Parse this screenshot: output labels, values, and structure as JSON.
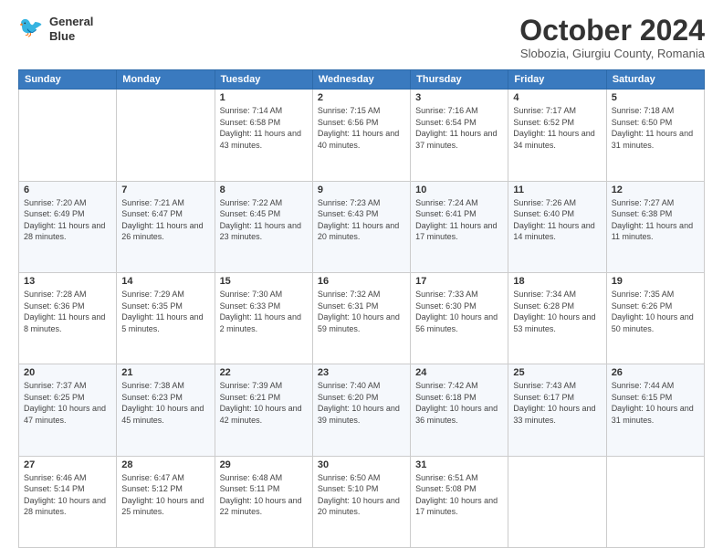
{
  "header": {
    "logo_line1": "General",
    "logo_line2": "Blue",
    "month_title": "October 2024",
    "subtitle": "Slobozia, Giurgiu County, Romania"
  },
  "days_of_week": [
    "Sunday",
    "Monday",
    "Tuesday",
    "Wednesday",
    "Thursday",
    "Friday",
    "Saturday"
  ],
  "weeks": [
    [
      {
        "day": "",
        "detail": ""
      },
      {
        "day": "",
        "detail": ""
      },
      {
        "day": "1",
        "detail": "Sunrise: 7:14 AM\nSunset: 6:58 PM\nDaylight: 11 hours and 43 minutes."
      },
      {
        "day": "2",
        "detail": "Sunrise: 7:15 AM\nSunset: 6:56 PM\nDaylight: 11 hours and 40 minutes."
      },
      {
        "day": "3",
        "detail": "Sunrise: 7:16 AM\nSunset: 6:54 PM\nDaylight: 11 hours and 37 minutes."
      },
      {
        "day": "4",
        "detail": "Sunrise: 7:17 AM\nSunset: 6:52 PM\nDaylight: 11 hours and 34 minutes."
      },
      {
        "day": "5",
        "detail": "Sunrise: 7:18 AM\nSunset: 6:50 PM\nDaylight: 11 hours and 31 minutes."
      }
    ],
    [
      {
        "day": "6",
        "detail": "Sunrise: 7:20 AM\nSunset: 6:49 PM\nDaylight: 11 hours and 28 minutes."
      },
      {
        "day": "7",
        "detail": "Sunrise: 7:21 AM\nSunset: 6:47 PM\nDaylight: 11 hours and 26 minutes."
      },
      {
        "day": "8",
        "detail": "Sunrise: 7:22 AM\nSunset: 6:45 PM\nDaylight: 11 hours and 23 minutes."
      },
      {
        "day": "9",
        "detail": "Sunrise: 7:23 AM\nSunset: 6:43 PM\nDaylight: 11 hours and 20 minutes."
      },
      {
        "day": "10",
        "detail": "Sunrise: 7:24 AM\nSunset: 6:41 PM\nDaylight: 11 hours and 17 minutes."
      },
      {
        "day": "11",
        "detail": "Sunrise: 7:26 AM\nSunset: 6:40 PM\nDaylight: 11 hours and 14 minutes."
      },
      {
        "day": "12",
        "detail": "Sunrise: 7:27 AM\nSunset: 6:38 PM\nDaylight: 11 hours and 11 minutes."
      }
    ],
    [
      {
        "day": "13",
        "detail": "Sunrise: 7:28 AM\nSunset: 6:36 PM\nDaylight: 11 hours and 8 minutes."
      },
      {
        "day": "14",
        "detail": "Sunrise: 7:29 AM\nSunset: 6:35 PM\nDaylight: 11 hours and 5 minutes."
      },
      {
        "day": "15",
        "detail": "Sunrise: 7:30 AM\nSunset: 6:33 PM\nDaylight: 11 hours and 2 minutes."
      },
      {
        "day": "16",
        "detail": "Sunrise: 7:32 AM\nSunset: 6:31 PM\nDaylight: 10 hours and 59 minutes."
      },
      {
        "day": "17",
        "detail": "Sunrise: 7:33 AM\nSunset: 6:30 PM\nDaylight: 10 hours and 56 minutes."
      },
      {
        "day": "18",
        "detail": "Sunrise: 7:34 AM\nSunset: 6:28 PM\nDaylight: 10 hours and 53 minutes."
      },
      {
        "day": "19",
        "detail": "Sunrise: 7:35 AM\nSunset: 6:26 PM\nDaylight: 10 hours and 50 minutes."
      }
    ],
    [
      {
        "day": "20",
        "detail": "Sunrise: 7:37 AM\nSunset: 6:25 PM\nDaylight: 10 hours and 47 minutes."
      },
      {
        "day": "21",
        "detail": "Sunrise: 7:38 AM\nSunset: 6:23 PM\nDaylight: 10 hours and 45 minutes."
      },
      {
        "day": "22",
        "detail": "Sunrise: 7:39 AM\nSunset: 6:21 PM\nDaylight: 10 hours and 42 minutes."
      },
      {
        "day": "23",
        "detail": "Sunrise: 7:40 AM\nSunset: 6:20 PM\nDaylight: 10 hours and 39 minutes."
      },
      {
        "day": "24",
        "detail": "Sunrise: 7:42 AM\nSunset: 6:18 PM\nDaylight: 10 hours and 36 minutes."
      },
      {
        "day": "25",
        "detail": "Sunrise: 7:43 AM\nSunset: 6:17 PM\nDaylight: 10 hours and 33 minutes."
      },
      {
        "day": "26",
        "detail": "Sunrise: 7:44 AM\nSunset: 6:15 PM\nDaylight: 10 hours and 31 minutes."
      }
    ],
    [
      {
        "day": "27",
        "detail": "Sunrise: 6:46 AM\nSunset: 5:14 PM\nDaylight: 10 hours and 28 minutes."
      },
      {
        "day": "28",
        "detail": "Sunrise: 6:47 AM\nSunset: 5:12 PM\nDaylight: 10 hours and 25 minutes."
      },
      {
        "day": "29",
        "detail": "Sunrise: 6:48 AM\nSunset: 5:11 PM\nDaylight: 10 hours and 22 minutes."
      },
      {
        "day": "30",
        "detail": "Sunrise: 6:50 AM\nSunset: 5:10 PM\nDaylight: 10 hours and 20 minutes."
      },
      {
        "day": "31",
        "detail": "Sunrise: 6:51 AM\nSunset: 5:08 PM\nDaylight: 10 hours and 17 minutes."
      },
      {
        "day": "",
        "detail": ""
      },
      {
        "day": "",
        "detail": ""
      }
    ]
  ]
}
